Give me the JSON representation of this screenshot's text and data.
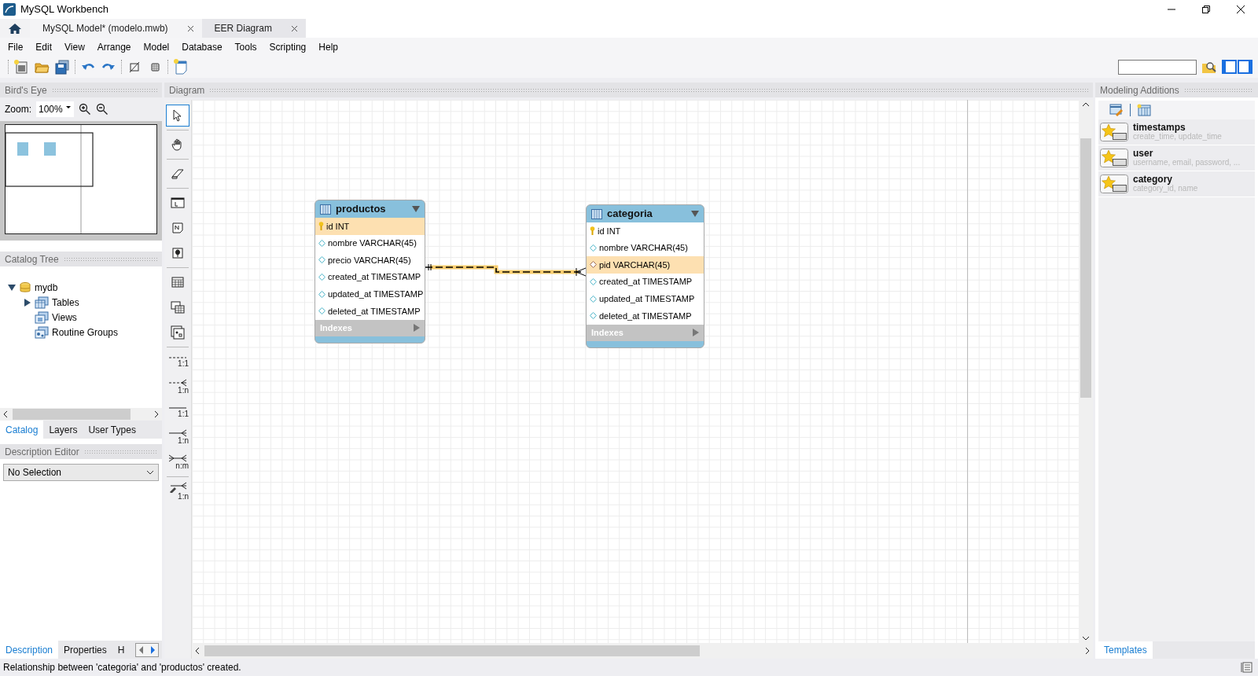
{
  "window": {
    "title": "MySQL Workbench"
  },
  "tabs": [
    {
      "label": "MySQL Model* (modelo.mwb)",
      "selected": false
    },
    {
      "label": "EER Diagram",
      "selected": true
    }
  ],
  "menu": [
    "File",
    "Edit",
    "View",
    "Arrange",
    "Model",
    "Database",
    "Tools",
    "Scripting",
    "Help"
  ],
  "birds_eye": {
    "title": "Bird's Eye",
    "zoom_label": "Zoom:",
    "zoom_value": "100%"
  },
  "catalog_tree": {
    "title": "Catalog Tree",
    "items": [
      {
        "label": "mydb",
        "kind": "schema",
        "expanded": true,
        "children": [
          {
            "label": "Tables",
            "kind": "tables",
            "expanded": false
          },
          {
            "label": "Views",
            "kind": "views"
          },
          {
            "label": "Routine Groups",
            "kind": "routines"
          }
        ]
      }
    ]
  },
  "catalog_tabs": [
    {
      "label": "Catalog",
      "selected": true
    },
    {
      "label": "Layers",
      "selected": false
    },
    {
      "label": "User Types",
      "selected": false
    }
  ],
  "description_editor": {
    "title": "Description Editor",
    "selection": "No Selection"
  },
  "bottom_tabs": [
    {
      "label": "Description",
      "selected": true
    },
    {
      "label": "Properties",
      "selected": false
    },
    {
      "label": "H",
      "selected": false
    }
  ],
  "diagram": {
    "title": "Diagram",
    "tool_palette": [
      {
        "tools": [
          {
            "kind": "pointer",
            "selected": true
          }
        ]
      },
      {
        "tools": [
          {
            "kind": "hand",
            "selected": false
          }
        ]
      },
      {
        "tools": [
          {
            "kind": "eraser",
            "selected": false
          }
        ]
      },
      {
        "tools": [
          {
            "kind": "layer",
            "selected": false
          },
          {
            "kind": "note",
            "selected": false
          },
          {
            "kind": "image",
            "selected": false
          }
        ]
      },
      {
        "tools": [
          {
            "kind": "table",
            "selected": false
          },
          {
            "kind": "view",
            "selected": false
          },
          {
            "kind": "routine",
            "selected": false
          }
        ]
      },
      {
        "tools": [
          {
            "kind": "dashed_one",
            "label": "1:1",
            "selected": false
          },
          {
            "kind": "dashed_many",
            "label": "1:n",
            "selected": false
          },
          {
            "kind": "solid_one",
            "label": "1:1",
            "selected": false
          },
          {
            "kind": "solid_many",
            "label": "1:n",
            "selected": false
          },
          {
            "kind": "many_many",
            "label": "n:m",
            "selected": false
          }
        ]
      },
      {
        "tools": [
          {
            "kind": "pick_many",
            "label": "1:n",
            "selected": false
          }
        ]
      }
    ],
    "tables": [
      {
        "name": "productos",
        "indexes_label": "Indexes",
        "columns": [
          {
            "label": "id INT",
            "kind": "primary",
            "highlighted": true
          },
          {
            "label": "nombre VARCHAR(45)",
            "kind": "column",
            "highlighted": false
          },
          {
            "label": "precio VARCHAR(45)",
            "kind": "column",
            "highlighted": false
          },
          {
            "label": "created_at TIMESTAMP",
            "kind": "column",
            "highlighted": false
          },
          {
            "label": "updated_at TIMESTAMP",
            "kind": "column",
            "highlighted": false
          },
          {
            "label": "deleted_at TIMESTAMP",
            "kind": "column",
            "highlighted": false
          }
        ]
      },
      {
        "name": "categoria",
        "indexes_label": "Indexes",
        "columns": [
          {
            "label": "id INT",
            "kind": "primary",
            "highlighted": false
          },
          {
            "label": "nombre VARCHAR(45)",
            "kind": "column",
            "highlighted": false
          },
          {
            "label": "pid VARCHAR(45)",
            "kind": "foreign",
            "highlighted": true
          },
          {
            "label": "created_at TIMESTAMP",
            "kind": "column",
            "highlighted": false
          },
          {
            "label": "updated_at TIMESTAMP",
            "kind": "column",
            "highlighted": false
          },
          {
            "label": "deleted_at TIMESTAMP",
            "kind": "column",
            "highlighted": false
          }
        ]
      }
    ],
    "relationships": [
      {
        "kind": "one_to_many",
        "identifying": false,
        "highlighted": true
      }
    ]
  },
  "modeling_additions": {
    "title": "Modeling Additions",
    "tab": "Templates",
    "templates": [
      {
        "name": "timestamps",
        "columns": "create_time, update_time"
      },
      {
        "name": "user",
        "columns": "username, email, password, ..."
      },
      {
        "name": "category",
        "columns": "category_id, name"
      }
    ]
  },
  "status_bar": "Relationship between 'categoria' and 'productos' created."
}
